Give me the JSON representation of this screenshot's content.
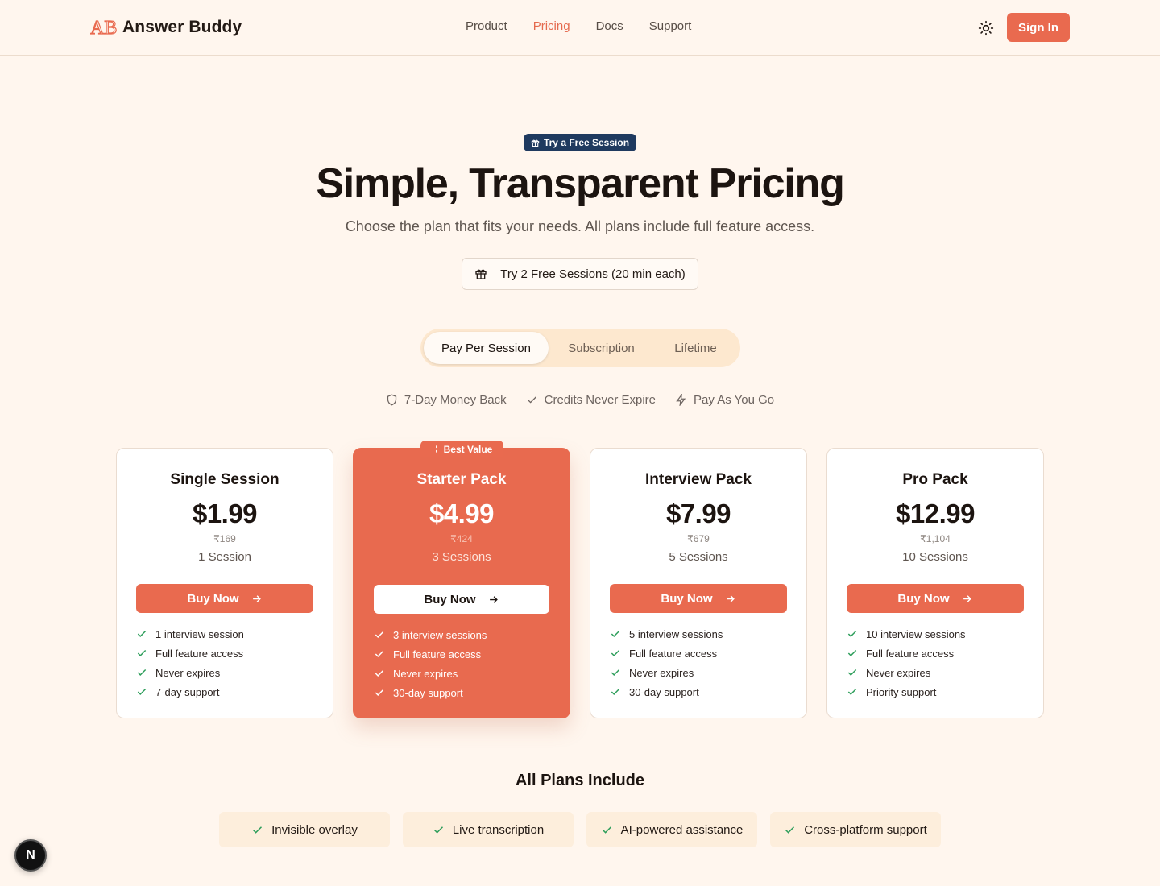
{
  "header": {
    "logo_mark": "AB",
    "brand": "Answer Buddy",
    "nav": [
      "Product",
      "Pricing",
      "Docs",
      "Support"
    ],
    "active_nav": "Pricing",
    "signin": "Sign In",
    "theme_icon": "sun-icon"
  },
  "hero": {
    "badge": "Try a Free Session",
    "title": "Simple, Transparent Pricing",
    "subtitle": "Choose the plan that fits your needs. All plans include full feature access.",
    "free_button": "Try 2 Free Sessions (20 min each)"
  },
  "tabs": [
    "Pay Per Session",
    "Subscription",
    "Lifetime"
  ],
  "active_tab": "Pay Per Session",
  "guarantees": [
    "7-Day Money Back",
    "Credits Never Expire",
    "Pay As You Go"
  ],
  "best_badge": "Best Value",
  "plans": [
    {
      "name": "Single Session",
      "price": "$1.99",
      "inr": "₹169",
      "sessions": "1 Session",
      "button": "Buy Now",
      "features": [
        "1 interview session",
        "Full feature access",
        "Never expires",
        "7-day support"
      ]
    },
    {
      "name": "Starter Pack",
      "price": "$4.99",
      "inr": "₹424",
      "sessions": "3 Sessions",
      "button": "Buy Now",
      "features": [
        "3 interview sessions",
        "Full feature access",
        "Never expires",
        "30-day support"
      ]
    },
    {
      "name": "Interview Pack",
      "price": "$7.99",
      "inr": "₹679",
      "sessions": "5 Sessions",
      "button": "Buy Now",
      "features": [
        "5 interview sessions",
        "Full feature access",
        "Never expires",
        "30-day support"
      ]
    },
    {
      "name": "Pro Pack",
      "price": "$12.99",
      "inr": "₹1,104",
      "sessions": "10 Sessions",
      "button": "Buy Now",
      "features": [
        "10 interview sessions",
        "Full feature access",
        "Never expires",
        "Priority support"
      ]
    }
  ],
  "all_plans": {
    "title": "All Plans Include",
    "items": [
      "Invisible overlay",
      "Live transcription",
      "AI-powered assistance",
      "Cross-platform support"
    ]
  },
  "dev_badge": "N",
  "colors": {
    "accent": "#e96a4f",
    "background": "#fff6ee",
    "check": "#2e9e5b",
    "badge_dark": "#1f3a5f"
  }
}
